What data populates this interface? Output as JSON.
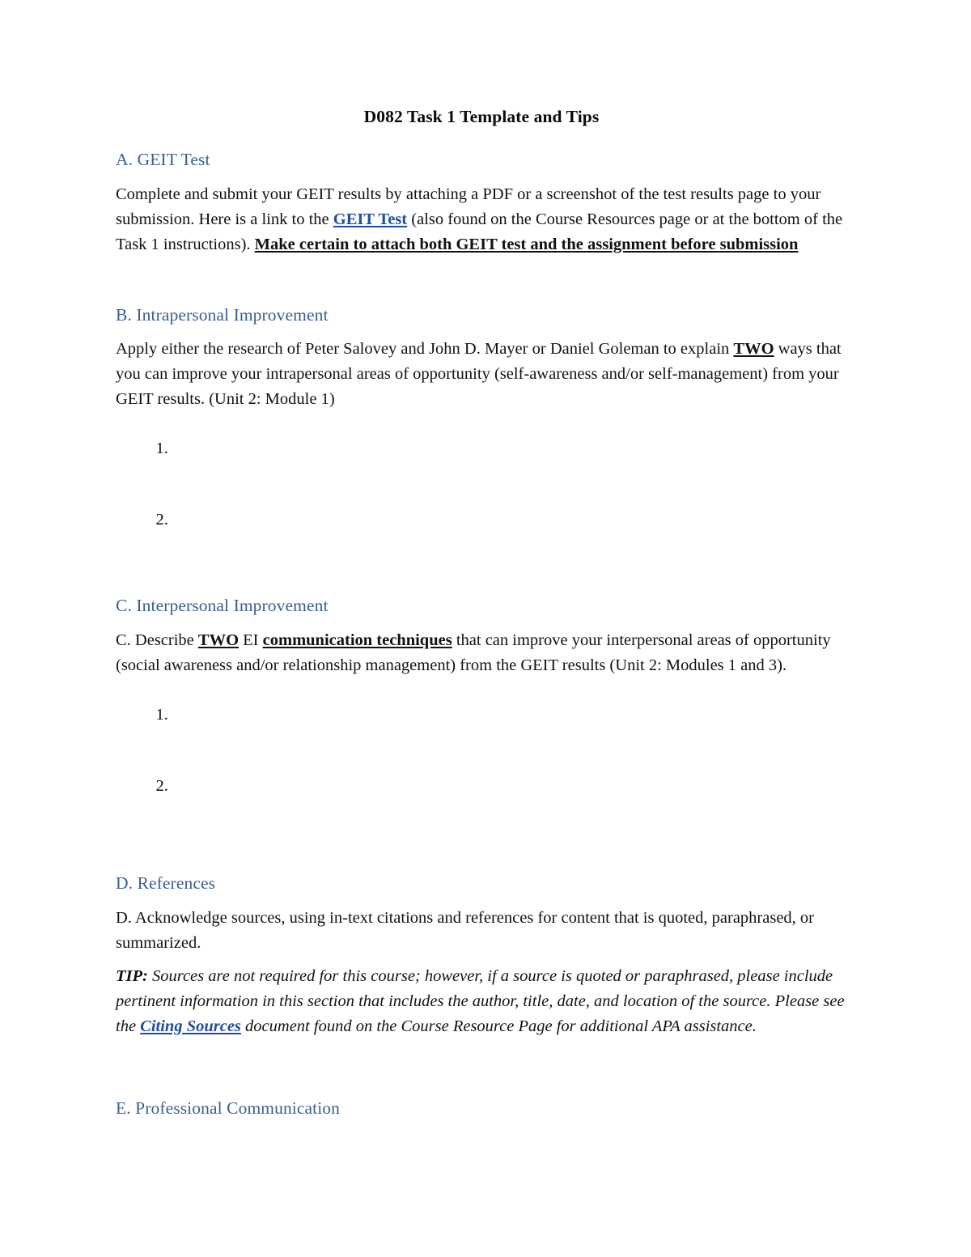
{
  "document": {
    "title": "D082 Task 1 Template and Tips"
  },
  "sections": {
    "a": {
      "heading": "A. GEIT Test",
      "body_1": "Complete and submit your GEIT results by attaching a PDF or a screenshot of the test results page to your submission.  Here is a link to the ",
      "link_label": "GEIT Test",
      "body_2": " (also found on the Course Resources page or at the bottom of the Task 1 instructions). ",
      "body_bold_underline": "Make certain to attach both GEIT test and the assignment before submission"
    },
    "b": {
      "heading": "B. Intrapersonal Improvement",
      "body_1": "Apply either the research of Peter Salovey and John D. Mayer or Daniel Goleman to explain ",
      "emphasis": "TWO",
      "body_2": " ways that you can improve your intrapersonal areas of opportunity (self-awareness and/or self-management) from your GEIT results. (Unit 2: Module 1)",
      "list": [
        "",
        ""
      ]
    },
    "c": {
      "heading": "C. Interpersonal Improvement",
      "body_1": "C. Describe ",
      "emphasis_1": "TWO",
      "body_2": " EI ",
      "emphasis_2": "communication techniques",
      "body_3": " that can improve your interpersonal areas of opportunity (social awareness and/or relationship management) from the GEIT results (Unit 2: Modules 1 and 3).",
      "list": [
        "",
        ""
      ]
    },
    "d": {
      "heading": "D. References",
      "body": "D. Acknowledge sources, using in-text citations and references for content that is quoted, paraphrased, or summarized.",
      "tip_label": "TIP:",
      "tip_body_1": " Sources are not required for this course; however, if a source is quoted or paraphrased, please include pertinent information in this section that includes the author, title, date, and location of the source. Please see the ",
      "tip_link_label": "Citing Sources",
      "tip_body_2": " document found on the Course Resource Page for additional APA assistance."
    },
    "e": {
      "heading": "E. Professional Communication"
    }
  },
  "colors": {
    "heading_blue": "#3a5e93",
    "link_blue": "#1f4ea0",
    "body_black": "#121212",
    "page_background": "#ffffff"
  }
}
